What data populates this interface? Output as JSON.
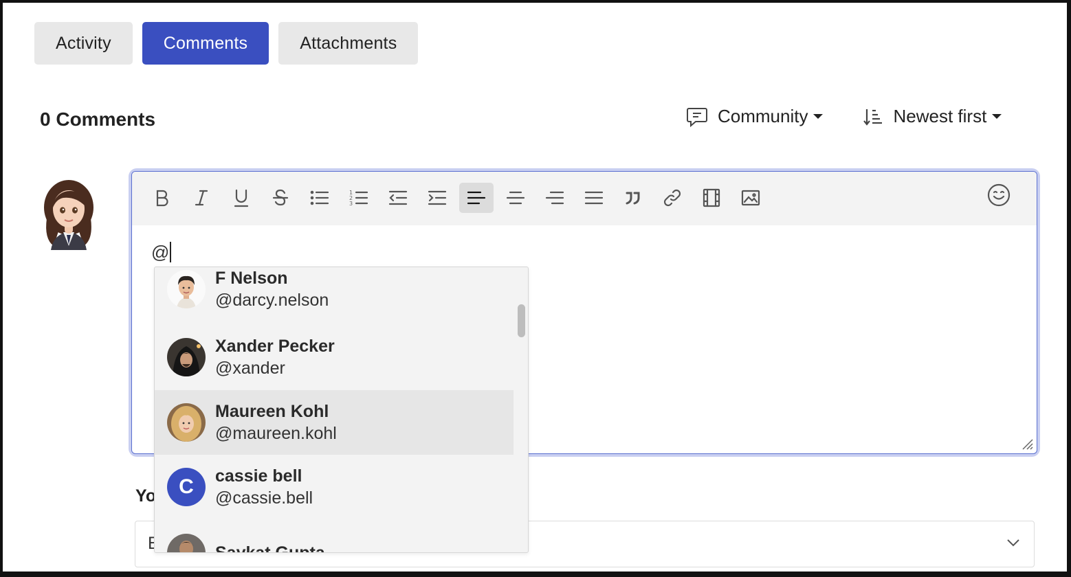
{
  "tabs": [
    {
      "label": "Activity",
      "active": false
    },
    {
      "label": "Comments",
      "active": true
    },
    {
      "label": "Attachments",
      "active": false
    }
  ],
  "header": {
    "count_label": "0 Comments",
    "audience_filter": "Community",
    "sort_filter": "Newest first"
  },
  "editor": {
    "toolbar": [
      {
        "icon": "bold-icon"
      },
      {
        "icon": "italic-icon"
      },
      {
        "icon": "underline-icon"
      },
      {
        "icon": "strikethrough-icon"
      },
      {
        "icon": "bullet-list-icon"
      },
      {
        "icon": "numbered-list-icon"
      },
      {
        "icon": "outdent-icon"
      },
      {
        "icon": "indent-icon"
      },
      {
        "icon": "align-left-icon",
        "active": true
      },
      {
        "icon": "align-center-icon"
      },
      {
        "icon": "align-right-icon"
      },
      {
        "icon": "align-justify-icon"
      },
      {
        "icon": "quote-icon"
      },
      {
        "icon": "link-icon"
      },
      {
        "icon": "video-icon"
      },
      {
        "icon": "image-icon"
      },
      {
        "icon": "emoji-icon"
      }
    ],
    "text": "@"
  },
  "mention_list": [
    {
      "name": "F Nelson",
      "handle": "@darcy.nelson",
      "avatar": "photo"
    },
    {
      "name": "Xander Pecker",
      "handle": "@xander",
      "avatar": "photo"
    },
    {
      "name": "Maureen Kohl",
      "handle": "@maureen.kohl",
      "avatar": "photo",
      "highlighted": true
    },
    {
      "name": "cassie bell",
      "handle": "@cassie.bell",
      "avatar_letter": "C",
      "avatar_color": "#3a4fc0"
    },
    {
      "name": "Saykat Gupta",
      "handle": "",
      "avatar": "photo"
    }
  ],
  "below": {
    "label_fragment": "Yo",
    "select_fragment": "E"
  },
  "colors": {
    "accent": "#3a4fc0",
    "tab_bg": "#e8e8e8",
    "focus_ring": "#c9cff1"
  }
}
